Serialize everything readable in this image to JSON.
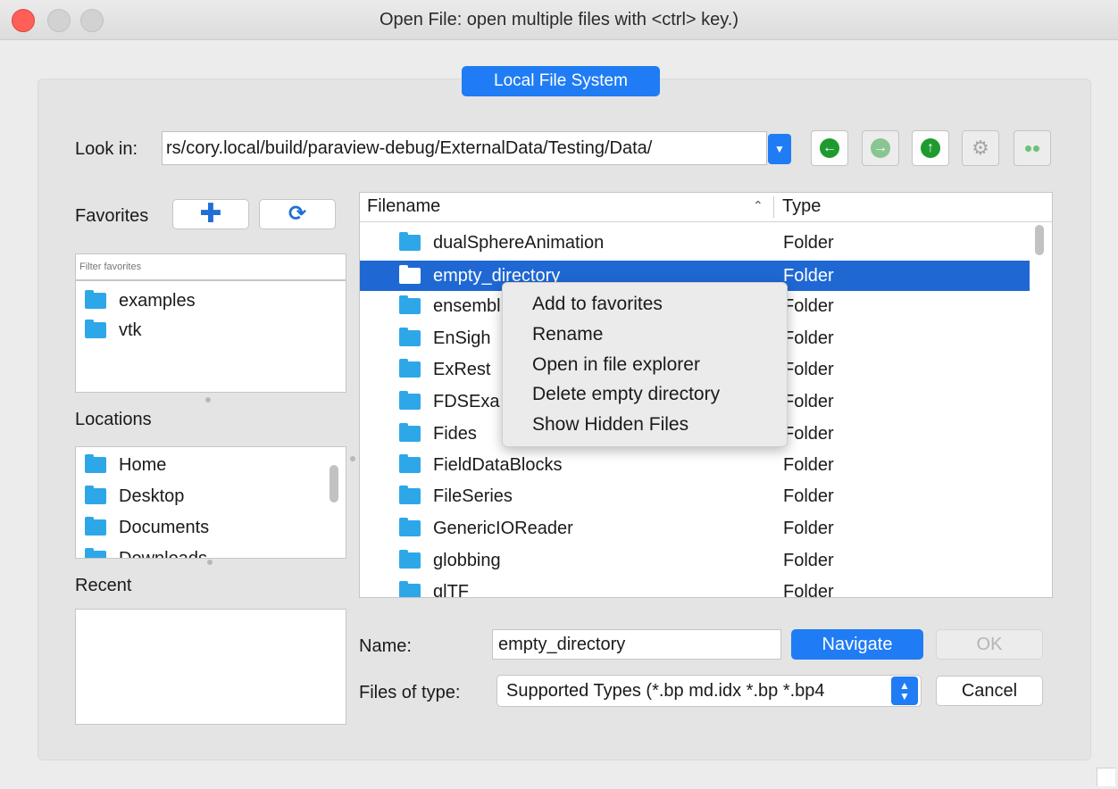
{
  "window": {
    "title": "Open File:  open multiple files with <ctrl> key.)"
  },
  "tab": {
    "label": "Local File System"
  },
  "lookin": {
    "label": "Look in:",
    "path": "rs/cory.local/build/paraview-debug/ExternalData/Testing/Data/"
  },
  "favorites": {
    "label": "Favorites",
    "filter_placeholder": "Filter favorites",
    "items": [
      {
        "label": "examples"
      },
      {
        "label": "vtk"
      }
    ]
  },
  "locations": {
    "label": "Locations",
    "items": [
      {
        "label": "Home"
      },
      {
        "label": "Desktop"
      },
      {
        "label": "Documents"
      },
      {
        "label": "Downloads"
      }
    ]
  },
  "recent": {
    "label": "Recent"
  },
  "filelist": {
    "columns": {
      "name": "Filename",
      "type": "Type"
    },
    "rows": [
      {
        "name": "dualSphereAnimation",
        "type": "Folder"
      },
      {
        "name": "empty_directory",
        "type": "Folder",
        "selected": true
      },
      {
        "name": "ensembl",
        "type": "Folder"
      },
      {
        "name": "EnSigh",
        "type": "Folder"
      },
      {
        "name": "ExRest",
        "type": "Folder"
      },
      {
        "name": "FDSExa",
        "type": "Folder"
      },
      {
        "name": "Fides",
        "type": "Folder"
      },
      {
        "name": "FieldDataBlocks",
        "type": "Folder"
      },
      {
        "name": "FileSeries",
        "type": "Folder"
      },
      {
        "name": "GenericIOReader",
        "type": "Folder"
      },
      {
        "name": "globbing",
        "type": "Folder"
      },
      {
        "name": "glTF",
        "type": "Folder"
      }
    ]
  },
  "context_menu": {
    "items": [
      {
        "label": "Add to favorites"
      },
      {
        "label": "Rename"
      },
      {
        "label": "Open in file explorer"
      },
      {
        "label": "Delete empty directory"
      },
      {
        "label": "Show Hidden Files"
      }
    ]
  },
  "form": {
    "name_label": "Name:",
    "name_value": "empty_directory",
    "type_label": "Files of type:",
    "type_value": "Supported Types (*.bp md.idx *.bp *.bp4"
  },
  "buttons": {
    "navigate": "Navigate",
    "ok": "OK",
    "cancel": "Cancel"
  },
  "colors": {
    "accent": "#1f7cf4",
    "selection": "#1f68d4",
    "folder": "#2ea7e8",
    "nav_green": "#1f9a2e"
  }
}
